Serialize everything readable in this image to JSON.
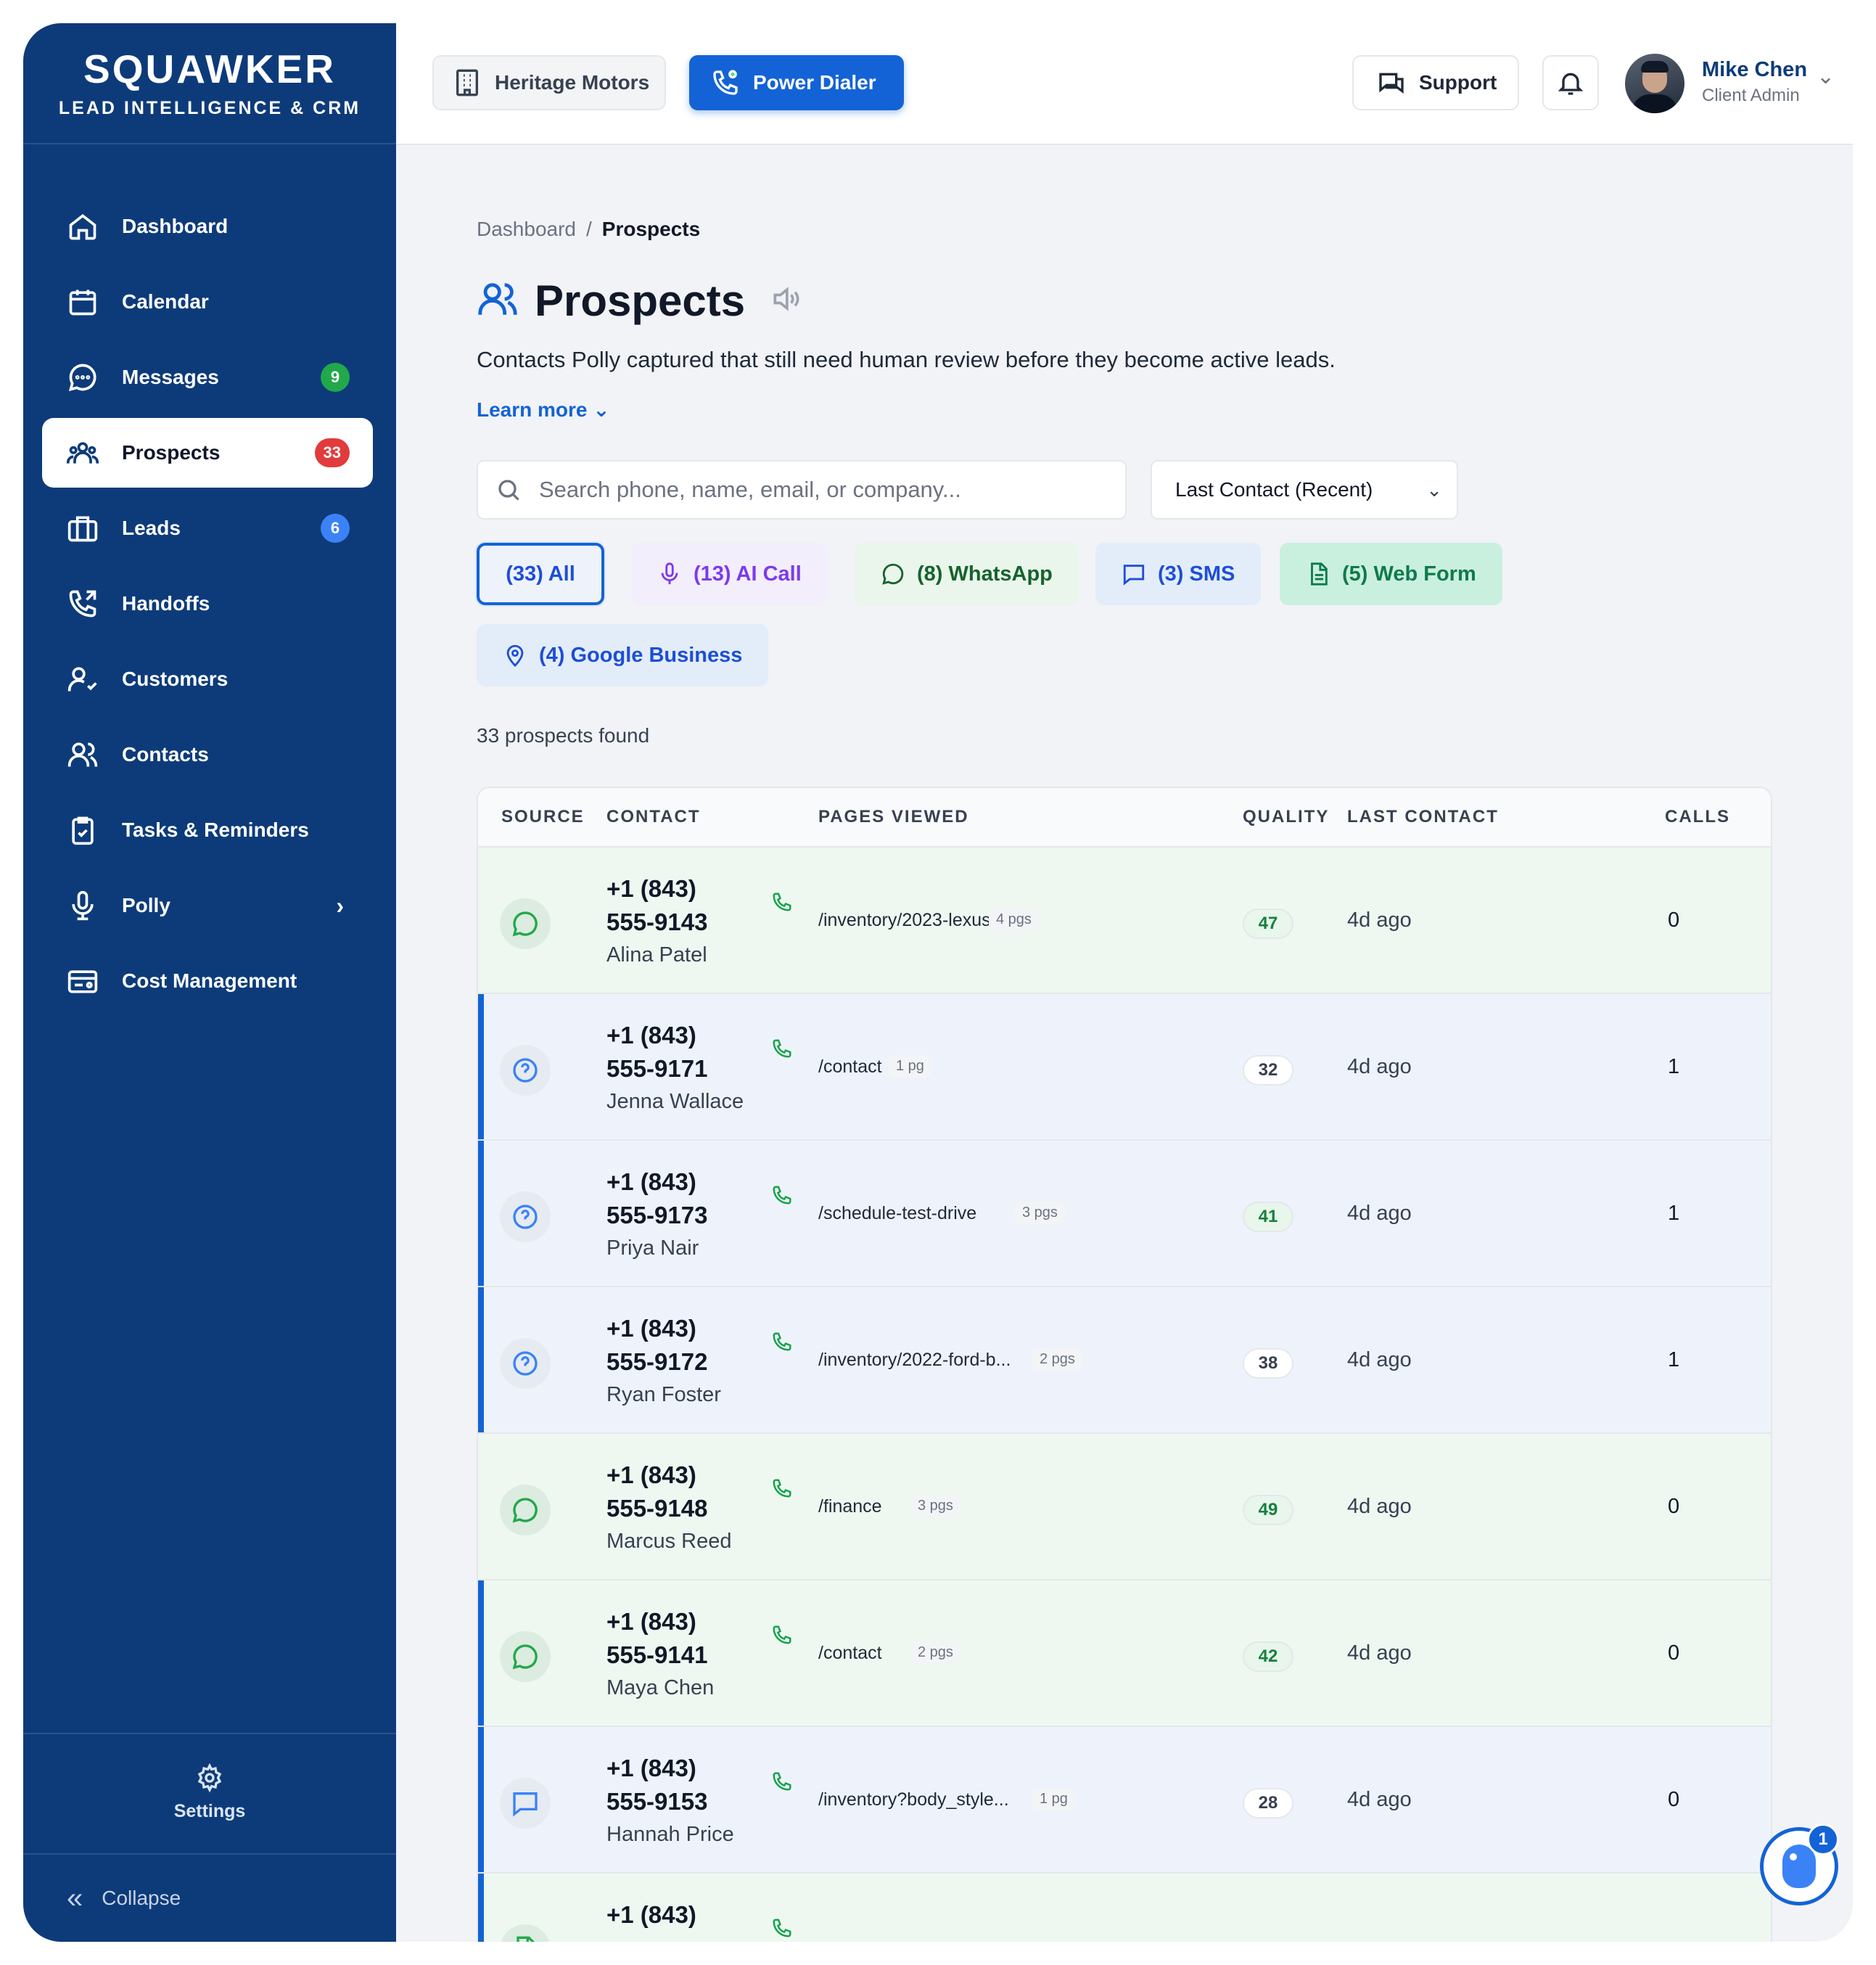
{
  "brand": {
    "name": "SQUAWKER",
    "subtitle": "LEAD INTELLIGENCE & CRM"
  },
  "sidebar": {
    "items": [
      {
        "label": "Dashboard",
        "icon": "home-icon"
      },
      {
        "label": "Calendar",
        "icon": "calendar-icon"
      },
      {
        "label": "Messages",
        "icon": "chat-icon",
        "badge": "9"
      },
      {
        "label": "Prospects",
        "icon": "users-group-icon",
        "badge": "33",
        "active": true
      },
      {
        "label": "Leads",
        "icon": "briefcase-icon",
        "badge": "6"
      },
      {
        "label": "Handoffs",
        "icon": "phone-forward-icon"
      },
      {
        "label": "Customers",
        "icon": "user-check-icon"
      },
      {
        "label": "Contacts",
        "icon": "users-icon"
      },
      {
        "label": "Tasks & Reminders",
        "icon": "clipboard-check-icon"
      },
      {
        "label": "Polly",
        "icon": "microphone-icon"
      },
      {
        "label": "Cost Management",
        "icon": "card-icon"
      }
    ],
    "settings_label": "Settings",
    "collapse_label": "Collapse"
  },
  "topbar": {
    "dealer": "Heritage Motors",
    "dialer": "Power Dialer",
    "support": "Support",
    "user_name": "Mike Chen",
    "user_role": "Client Admin"
  },
  "breadcrumb": {
    "parent": "Dashboard",
    "separator": "/",
    "current": "Prospects"
  },
  "page": {
    "title": "Prospects",
    "subtitle": "Contacts Polly captured that still need human review before they become active leads.",
    "learn_more": "Learn more"
  },
  "search": {
    "placeholder": "Search phone, name, email, or company..."
  },
  "sort": {
    "selected": "Last Contact (Recent)"
  },
  "filters": [
    {
      "label": "(33) All"
    },
    {
      "label": "(13) AI Call"
    },
    {
      "label": "(8) WhatsApp"
    },
    {
      "label": "(3) SMS"
    },
    {
      "label": "(5) Web Form"
    },
    {
      "label": "(4) Google Business"
    }
  ],
  "results_count": "33 prospects found",
  "table": {
    "headers": [
      "SOURCE",
      "CONTACT",
      "PAGES VIEWED",
      "QUALITY",
      "LAST CONTACT",
      "CALLS"
    ],
    "rows": [
      {
        "source": "whatsapp",
        "phone1": "+1 (843)",
        "phone2": "555-9143",
        "name": "Alina Patel",
        "page": "/inventory/2023-lexus-...",
        "pgs": "4 pgs",
        "quality": "47",
        "last": "4d ago",
        "calls": "0"
      },
      {
        "source": "question",
        "phone1": "+1 (843)",
        "phone2": "555-9171",
        "name": "Jenna Wallace",
        "page": "/contact",
        "pgs": "1 pg",
        "quality": "32",
        "last": "4d ago",
        "calls": "1"
      },
      {
        "source": "question",
        "phone1": "+1 (843)",
        "phone2": "555-9173",
        "name": "Priya Nair",
        "page": "/schedule-test-drive",
        "pgs": "3 pgs",
        "quality": "41",
        "last": "4d ago",
        "calls": "1"
      },
      {
        "source": "question",
        "phone1": "+1 (843)",
        "phone2": "555-9172",
        "name": "Ryan Foster",
        "page": "/inventory/2022-ford-b...",
        "pgs": "2 pgs",
        "quality": "38",
        "last": "4d ago",
        "calls": "1"
      },
      {
        "source": "whatsapp",
        "phone1": "+1 (843)",
        "phone2": "555-9148",
        "name": "Marcus Reed",
        "page": "/finance",
        "pgs": "3 pgs",
        "quality": "49",
        "last": "4d ago",
        "calls": "0"
      },
      {
        "source": "whatsapp",
        "phone1": "+1 (843)",
        "phone2": "555-9141",
        "name": "Maya Chen",
        "page": "/contact",
        "pgs": "2 pgs",
        "quality": "42",
        "last": "4d ago",
        "calls": "0"
      },
      {
        "source": "sms",
        "phone1": "+1 (843)",
        "phone2": "555-9153",
        "name": "Hannah Price",
        "page": "/inventory?body_style...",
        "pgs": "1 pg",
        "quality": "28",
        "last": "4d ago",
        "calls": "0"
      },
      {
        "source": "webform",
        "phone1": "+1 (843)",
        "phone2": "",
        "name": "",
        "page": "",
        "pgs": "",
        "quality": "",
        "last": "",
        "calls": ""
      }
    ]
  },
  "assistant": {
    "badge": "1"
  },
  "colors": {
    "sidebar": "#0d3b7a",
    "primary": "#1363d6",
    "green": "#22a84a",
    "red": "#e23b3b"
  }
}
